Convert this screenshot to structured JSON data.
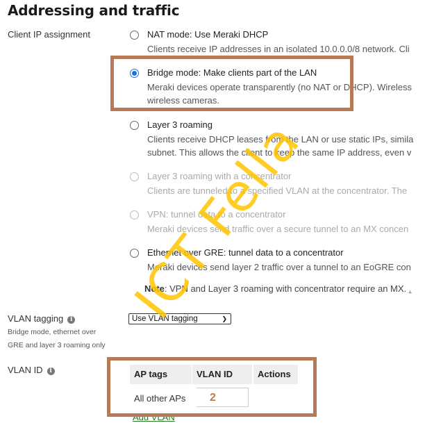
{
  "section_title": "Addressing and traffic",
  "client_ip": {
    "label": "Client IP assignment",
    "options": [
      {
        "title": "NAT mode: Use Meraki DHCP",
        "desc": [
          "Clients receive IP addresses in an isolated 10.0.0.0/8 network. Cli"
        ],
        "selected": false,
        "disabled": false
      },
      {
        "title": "Bridge mode: Make clients part of the LAN",
        "desc": [
          "Meraki devices operate transparently (no NAT or DHCP). Wireless",
          "wireless cameras."
        ],
        "selected": true,
        "disabled": false
      },
      {
        "title": "Layer 3 roaming",
        "desc": [
          "Clients receive DHCP leases from the LAN or use static IPs, simila",
          "subnet. This allows the client to keep the same IP address, even v"
        ],
        "selected": false,
        "disabled": false
      },
      {
        "title": "Layer 3 roaming with a concentrator",
        "desc": [
          "Clients are tunneled to a specified VLAN at the concentrator. The"
        ],
        "selected": false,
        "disabled": true
      },
      {
        "title": "VPN: tunnel data to a concentrator",
        "desc": [
          "Meraki devices send traffic over a secure tunnel to an MX concen"
        ],
        "selected": false,
        "disabled": true
      },
      {
        "title": "Ethernet over GRE: tunnel data to a concentrator",
        "desc": [
          "Meraki devices send layer 2 traffic over a tunnel to an EoGRE con"
        ],
        "selected": false,
        "disabled": false
      }
    ],
    "note_label": "Note",
    "note_text": ": VPN and Layer 3 roaming with concentrator require an MX. ",
    "note_link": "."
  },
  "vlan_tagging": {
    "label": "VLAN tagging",
    "info_icon": "i",
    "sublabel_line1": "Bridge mode, ethernet over",
    "sublabel_line2": "GRE and layer 3 roaming only",
    "selected": "Use VLAN tagging",
    "chevron": "⌄"
  },
  "vlan_id": {
    "label": "VLAN ID",
    "info_icon": "i",
    "columns": [
      "AP tags",
      "VLAN ID",
      "Actions"
    ],
    "rows": [
      {
        "ap_tags": "All other APs",
        "vlan_id": "2"
      }
    ],
    "add_link": "Add VLAN"
  },
  "watermark": "ICT Fella",
  "highlight_color": "#b77a56"
}
